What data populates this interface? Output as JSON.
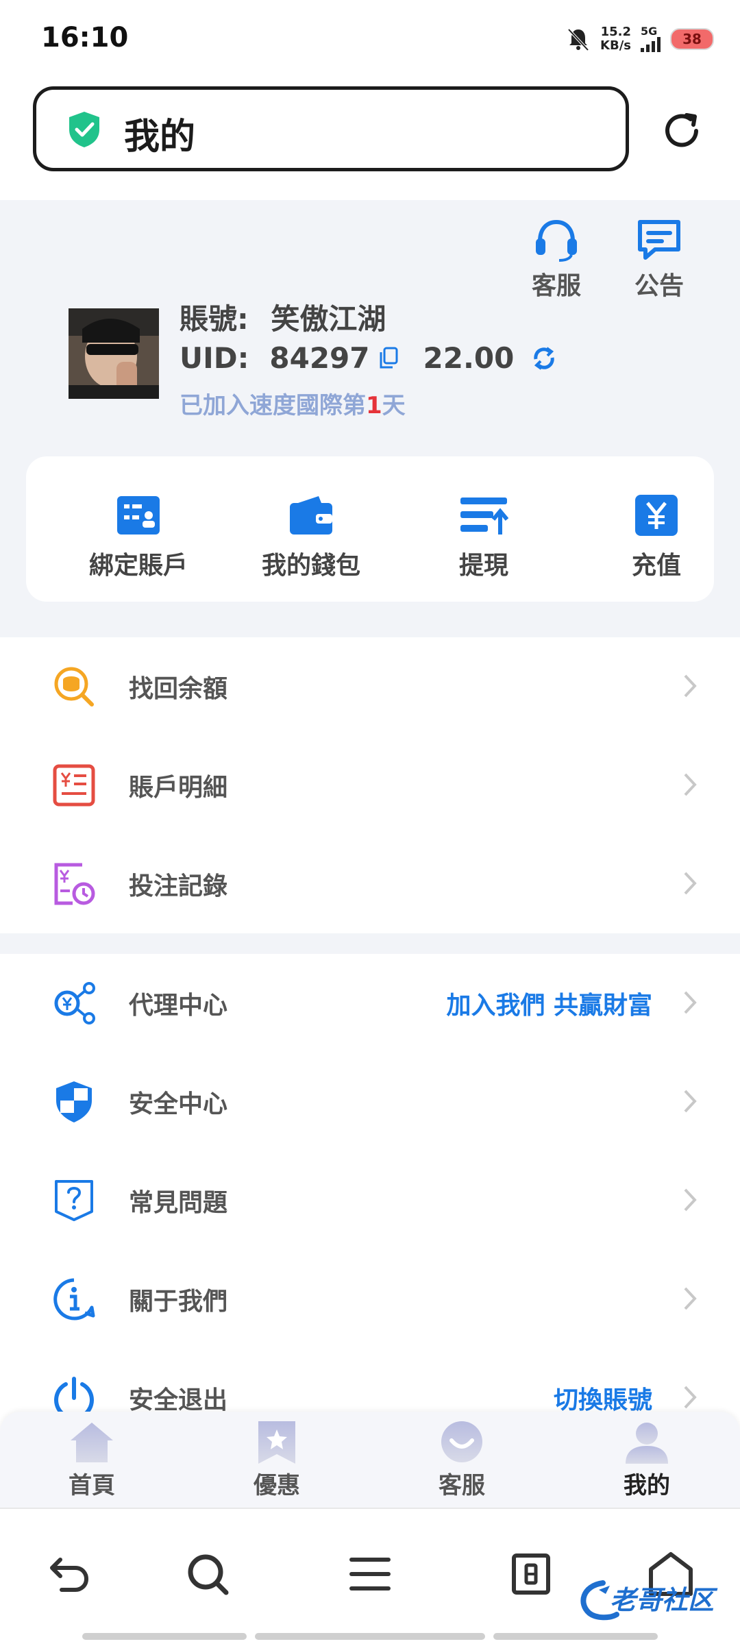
{
  "status_bar": {
    "time": "16:10",
    "net_speed_value": "15.2",
    "net_speed_unit": "KB/s",
    "network": "5G",
    "battery": "38"
  },
  "address_bar": {
    "title": "我的"
  },
  "profile": {
    "top_actions": [
      {
        "label": "客服",
        "icon": "headset-icon"
      },
      {
        "label": "公告",
        "icon": "announcement-icon"
      }
    ],
    "account_label": "賬號:",
    "account_name": "笑傲江湖",
    "uid_label": "UID:",
    "uid": "84297",
    "balance": "22.00",
    "join_prefix": "已加入速度國際第",
    "join_days": "1",
    "join_suffix": "天"
  },
  "quick_actions": [
    {
      "label": "綁定賬戶",
      "icon": "bind-account-icon"
    },
    {
      "label": "我的錢包",
      "icon": "wallet-icon"
    },
    {
      "label": "提現",
      "icon": "withdraw-icon"
    },
    {
      "label": "充值",
      "icon": "yen-icon"
    }
  ],
  "menu_group1": [
    {
      "label": "找回余額",
      "icon": "coin-search-icon"
    },
    {
      "label": "賬戶明細",
      "icon": "bill-icon"
    },
    {
      "label": "投注記錄",
      "icon": "bet-record-icon"
    }
  ],
  "menu_group2": [
    {
      "label": "代理中心",
      "extra": "加入我們 共贏財富",
      "icon": "agent-share-icon"
    },
    {
      "label": "安全中心",
      "extra": "",
      "icon": "shield-icon"
    },
    {
      "label": "常見問題",
      "extra": "",
      "icon": "question-icon"
    },
    {
      "label": "關于我們",
      "extra": "",
      "icon": "info-icon"
    },
    {
      "label": "安全退出",
      "extra": "切換賬號",
      "icon": "power-icon"
    }
  ],
  "tabs": [
    {
      "label": "首頁",
      "icon": "home-icon"
    },
    {
      "label": "優惠",
      "icon": "star-bookmark-icon"
    },
    {
      "label": "客服",
      "icon": "chat-icon"
    },
    {
      "label": "我的",
      "icon": "user-icon"
    }
  ],
  "watermark": "老哥社区",
  "colors": {
    "accent": "#1a7ae6",
    "days_highlight": "#e5333a",
    "battery": "#f26a6a"
  }
}
